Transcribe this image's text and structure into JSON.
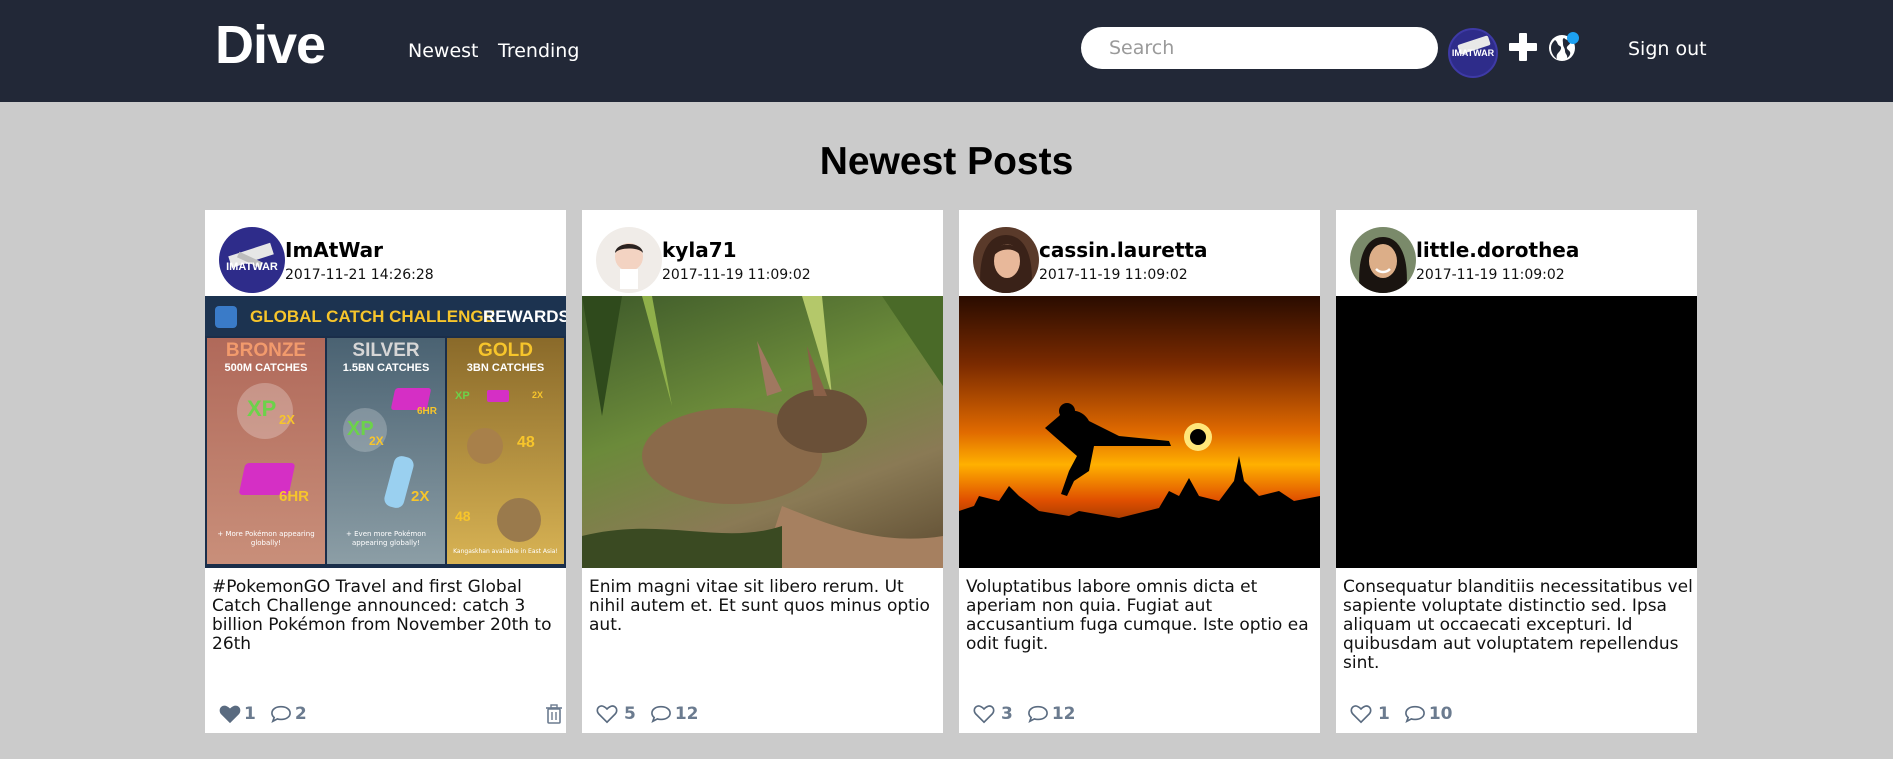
{
  "nav": {
    "logo": "Dive",
    "links": [
      "Newest",
      "Trending"
    ],
    "search_placeholder": "Search",
    "avatar_text": "IMATWAR",
    "signout": "Sign out"
  },
  "page": {
    "title": "Newest Posts"
  },
  "posts": [
    {
      "user": "ImAtWar",
      "time": "2017-11-21 14:26:28",
      "avatar_text": "IMATWAR",
      "image": {
        "banner": "GLOBAL CATCH CHALLENGE",
        "banner_accent": "REWARDS",
        "tiers": [
          {
            "name": "BRONZE",
            "catches": "500M CATCHES",
            "items": [
              "XP",
              "2X",
              "6HR"
            ],
            "footer": "+ More Pokémon appearing globally!"
          },
          {
            "name": "SILVER",
            "catches": "1.5BN CATCHES",
            "items": [
              "XP",
              "2X",
              "6HR",
              "2X"
            ],
            "footer": "+ Even more Pokémon appearing globally!"
          },
          {
            "name": "GOLD",
            "catches": "3BN CATCHES",
            "items": [
              "XP",
              "2X",
              "48",
              "48"
            ],
            "footer": "Kangaskhan available in East Asia!"
          }
        ]
      },
      "text": "#PokemonGO Travel and first Global Catch Challenge announced: catch 3 billion Pokémon from November 20th to 26th",
      "likes": "1",
      "comments": "2",
      "liked": true,
      "deletable": true
    },
    {
      "user": "kyla71",
      "time": "2017-11-19 11:09:02",
      "text": "Enim magni vitae sit libero rerum. Ut nihil autem et. Et sunt quos minus optio aut.",
      "likes": "5",
      "comments": "12",
      "liked": false,
      "deletable": false
    },
    {
      "user": "cassin.lauretta",
      "time": "2017-11-19 11:09:02",
      "text": "Voluptatibus labore omnis dicta et aperiam non quia. Fugiat aut accusantium fuga cumque. Iste optio ea odit fugit.",
      "likes": "3",
      "comments": "12",
      "liked": false,
      "deletable": false
    },
    {
      "user": "little.dorothea",
      "time": "2017-11-19 11:09:02",
      "text": "Consequatur blanditiis necessitatibus vel sapiente voluptate distinctio sed. Ipsa aliquam ut occaecati excepturi. Id quibusdam aut voluptatem repellendus sint.",
      "likes": "1",
      "comments": "10",
      "liked": false,
      "deletable": false
    }
  ],
  "colors": {
    "nav_bg": "#222837",
    "page_bg": "#cbcbcb",
    "action_gray": "#6b7b8f",
    "notif_dot": "#1da1f2"
  }
}
